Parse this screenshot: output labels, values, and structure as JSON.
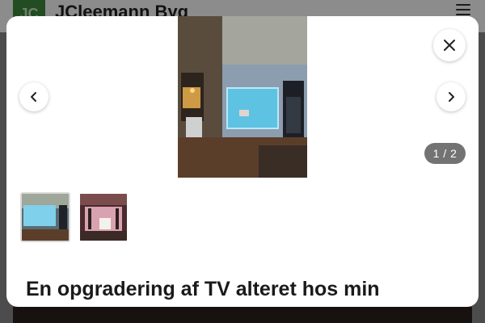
{
  "site": {
    "logo_text": "JC",
    "title": "JCleemann Byg"
  },
  "gallery": {
    "counter": "1 / 2",
    "images": [
      {
        "alt": "TV-væg med indbygget fjernsyn og belysning",
        "active": true
      },
      {
        "alt": "TV-væg set fra anden vinkel",
        "active": false
      }
    ]
  },
  "post": {
    "title": "En opgradering af TV alteret hos min"
  },
  "icons": {
    "close": "close-icon",
    "prev": "chevron-left-icon",
    "next": "chevron-right-icon",
    "menu": "hamburger-menu-icon"
  },
  "colors": {
    "brand_green": "#3f8a3c",
    "counter_bg": "#5a5a5a"
  }
}
